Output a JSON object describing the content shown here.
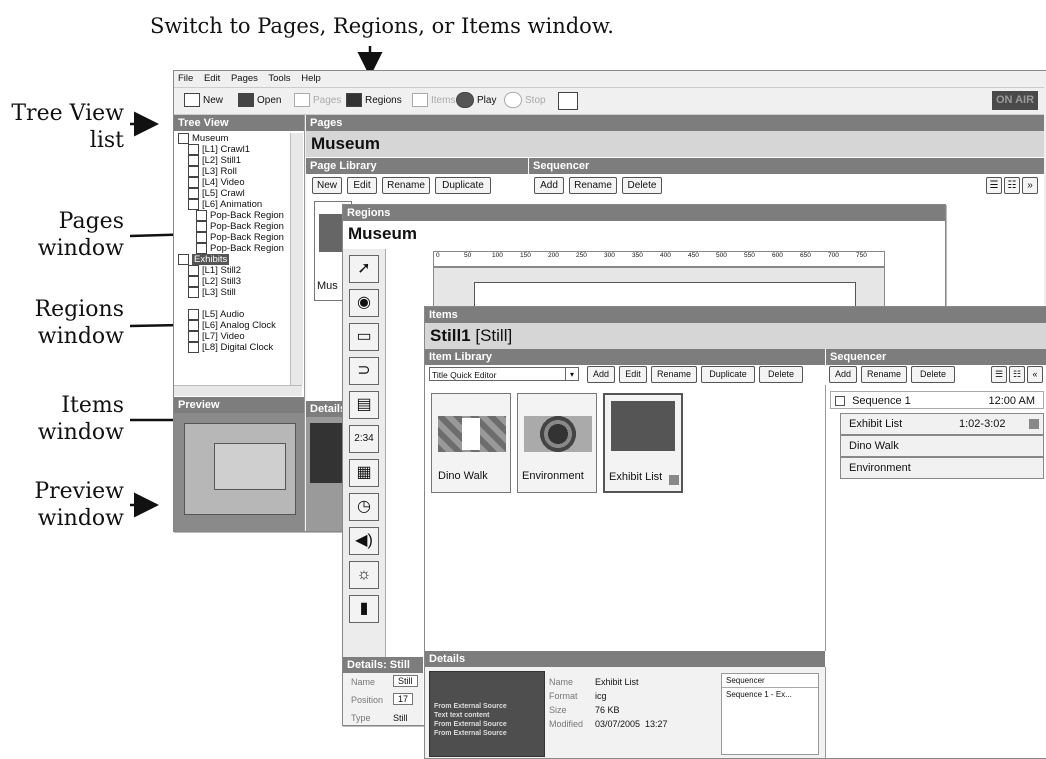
{
  "annotations": {
    "top": "Switch to Pages, Regions, or Items window.",
    "tree_view": [
      "Tree View",
      "list"
    ],
    "pages": [
      "Pages",
      "window"
    ],
    "regions": [
      "Regions",
      "window"
    ],
    "items": [
      "Items",
      "window"
    ],
    "preview": [
      "Preview",
      "window"
    ]
  },
  "menu": [
    "File",
    "Edit",
    "Pages",
    "Tools",
    "Help"
  ],
  "toolbar": {
    "new": "New",
    "open": "Open",
    "pages": "Pages",
    "regions": "Regions",
    "items": "Items",
    "play": "Play",
    "stop": "Stop",
    "on_air": "ON AIR"
  },
  "tree": {
    "header": "Tree View",
    "rows": [
      "Museum",
      "[L1] Crawl1",
      "[L2] Still1",
      "[L3] Roll",
      "[L4] Video",
      "[L5] Crawl",
      "[L6] Animation",
      "Pop-Back Region",
      "Pop-Back Region",
      "Pop-Back Region",
      "Pop-Back Region",
      "Exhibits",
      "[L1] Still2",
      "[L2] Still3",
      "[L3] Still",
      "[L5] Audio",
      "[L6] Analog Clock",
      "[L7] Video",
      "[L8] Digital Clock"
    ],
    "preview_header": "Preview"
  },
  "pages_window": {
    "bar": "Pages",
    "title": "Museum",
    "library": "Page Library",
    "sequencer": "Sequencer",
    "buttons": [
      "New",
      "Edit",
      "Rename",
      "Duplicate"
    ],
    "seq_buttons": [
      "Add",
      "Rename",
      "Delete"
    ],
    "thumb_label": "Mus",
    "details": "Details"
  },
  "regions_window": {
    "bar": "Regions",
    "title": "Museum",
    "ruler": [
      "0",
      "50",
      "100",
      "150",
      "200",
      "250",
      "300",
      "350",
      "400",
      "450",
      "500",
      "550",
      "600",
      "650",
      "700",
      "750"
    ],
    "details": "Details: Still",
    "name_key": "Name",
    "name_val": "Still",
    "position_key": "Position",
    "position_val": "17",
    "type_key": "Type",
    "type_val": "Still"
  },
  "items_window": {
    "bar": "Items",
    "title_bold": "Still1",
    "title_rest": "[Still]",
    "library": "Item Library",
    "sequencer": "Sequencer",
    "dropdown": "Title Quick Editor",
    "buttons": [
      "Add",
      "Edit",
      "Rename",
      "Duplicate",
      "Delete"
    ],
    "seq_buttons": [
      "Add",
      "Rename",
      "Delete"
    ],
    "thumbs": [
      "Dino Walk",
      "Environment",
      "Exhibit List"
    ],
    "seq_root": "Sequence 1",
    "seq_root_time": "12:00 AM",
    "seq_items": [
      {
        "name": "Exhibit List",
        "time": "1:02-3:02"
      },
      {
        "name": "Dino Walk",
        "time": ""
      },
      {
        "name": "Environment",
        "time": ""
      }
    ],
    "details": {
      "bar": "Details",
      "thumb_lines": [
        "From External Source",
        "Text text content",
        "From External Source",
        "From External Source"
      ],
      "name_key": "Name",
      "name_val": "Exhibit List",
      "format_key": "Format",
      "format_val": "icg",
      "size_key": "Size",
      "size_val": "76 KB",
      "modified_key": "Modified",
      "modified_val": "03/07/2005  13:27",
      "seq_header": "Sequencer",
      "seq_val": "Sequence 1 - Ex..."
    }
  }
}
